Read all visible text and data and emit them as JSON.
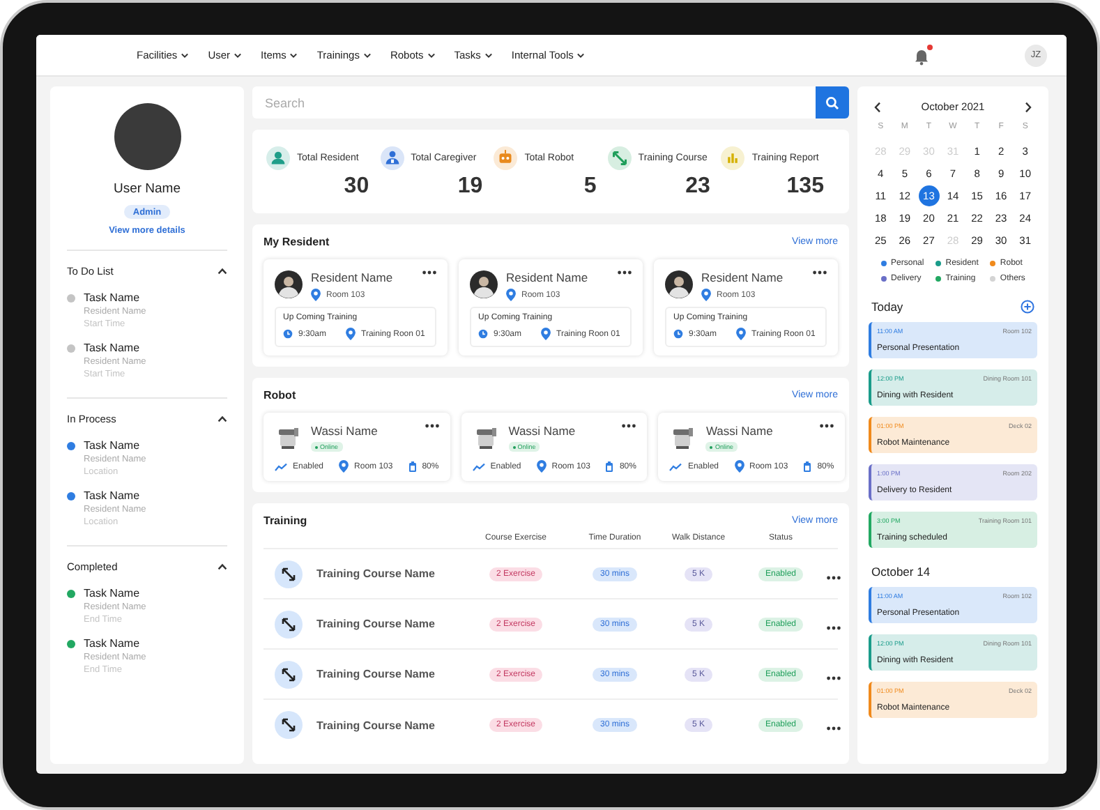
{
  "nav": {
    "items": [
      "Facilities",
      "User",
      "Items",
      "Trainings",
      "Robots",
      "Tasks",
      "Internal Tools"
    ],
    "notification_badge": true,
    "avatar_initials": "JZ"
  },
  "profile": {
    "name": "User Name",
    "role": "Admin",
    "link": "View more details"
  },
  "task_groups": [
    {
      "title": "To Do List",
      "expanded": true,
      "color": "#c4c4c4",
      "tasks": [
        {
          "name": "Task Name",
          "resident": "Resident Name",
          "detail": "Start Time"
        },
        {
          "name": "Task Name",
          "resident": "Resident Name",
          "detail": "Start Time"
        }
      ]
    },
    {
      "title": "In Process",
      "expanded": true,
      "color": "#2f7de1",
      "tasks": [
        {
          "name": "Task Name",
          "resident": "Resident Name",
          "detail": "Location"
        },
        {
          "name": "Task Name",
          "resident": "Resident Name",
          "detail": "Location"
        }
      ]
    },
    {
      "title": "Completed",
      "expanded": true,
      "color": "#22a862",
      "tasks": [
        {
          "name": "Task Name",
          "resident": "Resident Name",
          "detail": "End Time"
        },
        {
          "name": "Task Name",
          "resident": "Resident Name",
          "detail": "End Time"
        }
      ]
    }
  ],
  "search": {
    "placeholder": "Search"
  },
  "stats": [
    {
      "kind": "resident",
      "label": "Total Resident",
      "value": "30",
      "color": "#1f9e89"
    },
    {
      "kind": "caregiver",
      "label": "Total Caregiver",
      "value": "19",
      "color": "#2f6fd6"
    },
    {
      "kind": "robot",
      "label": "Total Robot",
      "value": "5",
      "color": "#e8891d"
    },
    {
      "kind": "course",
      "label": "Training Course",
      "value": "23",
      "color": "#1f9e5a"
    },
    {
      "kind": "report",
      "label": "Training Report",
      "value": "135",
      "color": "#d4b000"
    }
  ],
  "residents": {
    "title": "My Resident",
    "link": "View more",
    "cards": [
      {
        "name": "Resident Name",
        "room": "Room 103",
        "training_title": "Up Coming Training",
        "time": "9:30am",
        "location": "Training Roon 01"
      },
      {
        "name": "Resident Name",
        "room": "Room 103",
        "training_title": "Up Coming Training",
        "time": "9:30am",
        "location": "Training Roon 01"
      },
      {
        "name": "Resident Name",
        "room": "Room 103",
        "training_title": "Up Coming Training",
        "time": "9:30am",
        "location": "Training Roon 01"
      }
    ]
  },
  "robots": {
    "title": "Robot",
    "link": "View more",
    "cards": [
      {
        "name": "Wassi Name",
        "status": "Online",
        "state": "Enabled",
        "room": "Room 103",
        "battery": "80%"
      },
      {
        "name": "Wassi Name",
        "status": "Online",
        "state": "Enabled",
        "room": "Room 103",
        "battery": "80%"
      },
      {
        "name": "Wassi Name",
        "status": "Online",
        "state": "Enabled",
        "room": "Room 103",
        "battery": "80%"
      }
    ]
  },
  "training": {
    "title": "Training",
    "link": "View more",
    "columns": [
      "Course Exercise",
      "Time Duration",
      "Walk Distance",
      "Status"
    ],
    "rows": [
      {
        "name": "Training Course Name",
        "exercise": "2 Exercise",
        "duration": "30 mins",
        "distance": "5 K",
        "status": "Enabled"
      },
      {
        "name": "Training Course Name",
        "exercise": "2 Exercise",
        "duration": "30 mins",
        "distance": "5 K",
        "status": "Enabled"
      },
      {
        "name": "Training Course Name",
        "exercise": "2 Exercise",
        "duration": "30 mins",
        "distance": "5 K",
        "status": "Enabled"
      },
      {
        "name": "Training Course Name",
        "exercise": "2 Exercise",
        "duration": "30 mins",
        "distance": "5 K",
        "status": "Enabled"
      }
    ]
  },
  "calendar": {
    "month": "October 2021",
    "weekdays": [
      "S",
      "M",
      "T",
      "W",
      "T",
      "F",
      "S"
    ],
    "days": [
      {
        "label": "28",
        "muted": true,
        "selected": false
      },
      {
        "label": "29",
        "muted": true,
        "selected": false
      },
      {
        "label": "30",
        "muted": true,
        "selected": false
      },
      {
        "label": "31",
        "muted": true,
        "selected": false
      },
      {
        "label": "1",
        "muted": false,
        "selected": false
      },
      {
        "label": "2",
        "muted": false,
        "selected": false
      },
      {
        "label": "3",
        "muted": false,
        "selected": false
      },
      {
        "label": "4",
        "muted": false,
        "selected": false
      },
      {
        "label": "5",
        "muted": false,
        "selected": false
      },
      {
        "label": "6",
        "muted": false,
        "selected": false
      },
      {
        "label": "7",
        "muted": false,
        "selected": false
      },
      {
        "label": "8",
        "muted": false,
        "selected": false
      },
      {
        "label": "9",
        "muted": false,
        "selected": false
      },
      {
        "label": "10",
        "muted": false,
        "selected": false
      },
      {
        "label": "11",
        "muted": false,
        "selected": false
      },
      {
        "label": "12",
        "muted": false,
        "selected": false
      },
      {
        "label": "13",
        "muted": false,
        "selected": true
      },
      {
        "label": "14",
        "muted": false,
        "selected": false
      },
      {
        "label": "15",
        "muted": false,
        "selected": false
      },
      {
        "label": "16",
        "muted": false,
        "selected": false
      },
      {
        "label": "17",
        "muted": false,
        "selected": false
      },
      {
        "label": "18",
        "muted": false,
        "selected": false
      },
      {
        "label": "19",
        "muted": false,
        "selected": false
      },
      {
        "label": "20",
        "muted": false,
        "selected": false
      },
      {
        "label": "21",
        "muted": false,
        "selected": false
      },
      {
        "label": "22",
        "muted": false,
        "selected": false
      },
      {
        "label": "23",
        "muted": false,
        "selected": false
      },
      {
        "label": "24",
        "muted": false,
        "selected": false
      },
      {
        "label": "25",
        "muted": false,
        "selected": false
      },
      {
        "label": "26",
        "muted": false,
        "selected": false
      },
      {
        "label": "27",
        "muted": false,
        "selected": false
      },
      {
        "label": "28",
        "muted": true,
        "selected": false
      },
      {
        "label": "29",
        "muted": false,
        "selected": false
      },
      {
        "label": "30",
        "muted": false,
        "selected": false
      },
      {
        "label": "31",
        "muted": false,
        "selected": false
      }
    ],
    "legend": [
      {
        "label": "Personal",
        "color": "#2f7de1"
      },
      {
        "label": "Resident",
        "color": "#1a9c8a"
      },
      {
        "label": "Robot",
        "color": "#f08a1c"
      },
      {
        "label": "Delivery",
        "color": "#6a6fc7"
      },
      {
        "label": "Training",
        "color": "#22a862"
      },
      {
        "label": "Others",
        "color": "#d4d4d4"
      }
    ]
  },
  "agenda": [
    {
      "title": "Today",
      "add_button": true,
      "events": [
        {
          "time": "11:00 AM",
          "place": "Room 102",
          "title": "Personal Presentation",
          "color": "#2f7de1"
        },
        {
          "time": "12:00 PM",
          "place": "Dining Room 101",
          "title": "Dining with Resident",
          "color": "#1a9c8a"
        },
        {
          "time": "01:00 PM",
          "place": "Deck 02",
          "title": "Robot Maintenance",
          "color": "#f08a1c"
        },
        {
          "time": "1:00 PM",
          "place": "Room 202",
          "title": "Delivery to Resident",
          "color": "#6a6fc7"
        },
        {
          "time": "3:00 PM",
          "place": "Training Room 101",
          "title": "Training scheduled",
          "color": "#22a862"
        }
      ]
    },
    {
      "title": "October 14",
      "add_button": false,
      "events": [
        {
          "time": "11:00 AM",
          "place": "Room 102",
          "title": "Personal Presentation",
          "color": "#2f7de1"
        },
        {
          "time": "12:00 PM",
          "place": "Dining Room 101",
          "title": "Dining with Resident",
          "color": "#1a9c8a"
        },
        {
          "time": "01:00 PM",
          "place": "Deck 02",
          "title": "Robot Maintenance",
          "color": "#f08a1c"
        }
      ]
    }
  ]
}
